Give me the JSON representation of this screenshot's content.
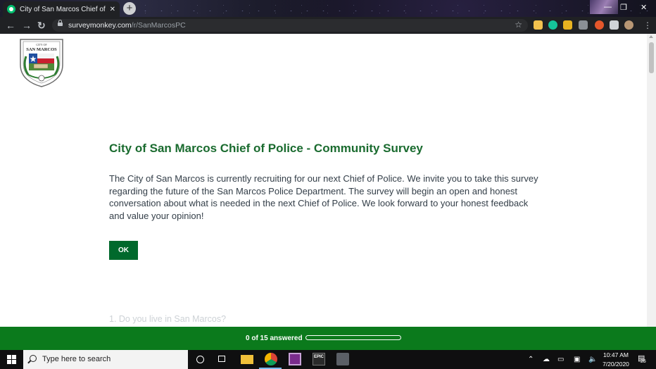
{
  "browser": {
    "tab_title": "City of San Marcos Chief of Polic",
    "tab_close": "✕",
    "new_tab": "+",
    "url_host": "surveymonkey.com",
    "url_path": "/r/SanMarcosPC",
    "back": "←",
    "forward": "→",
    "reload": "↻",
    "star": "☆",
    "win_minimize": "—",
    "win_restore": "❐",
    "win_close": "✕"
  },
  "logo": {
    "text_top": "CITY OF",
    "text_main": "SAN MARCOS"
  },
  "survey": {
    "title": "City of San Marcos Chief of Police - Community Survey",
    "intro": "The City of San Marcos is currently recruiting for our next Chief of Police.  We invite you to take this survey regarding the future of the San Marcos Police Department. The survey will begin an open and honest conversation about what is needed in the next Chief of Police. We look forward to your honest feedback and value your opinion!",
    "ok_label": "OK",
    "next_question": "1. Do you live in San Marcos?"
  },
  "progress": {
    "answered": 0,
    "total": 15,
    "label": "0 of 15 answered"
  },
  "taskbar": {
    "search_placeholder": "Type here to search",
    "time": "10:47 AM",
    "date": "7/20/2020",
    "notifications": "25",
    "epic_label": "EPIC"
  },
  "colors": {
    "title_green": "#1a6b2f",
    "button_green": "#00692c",
    "footer_green": "#0b7a1c"
  }
}
